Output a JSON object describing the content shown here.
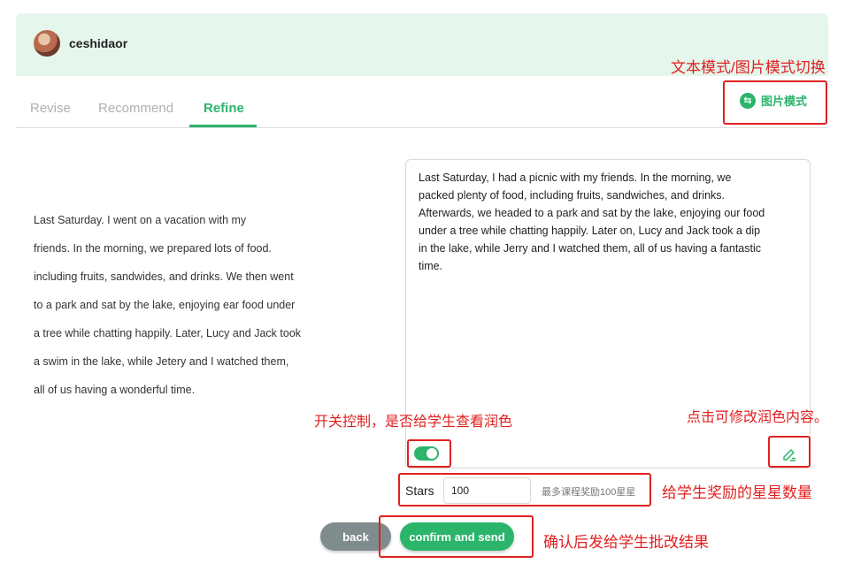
{
  "header": {
    "username": "ceshidaor"
  },
  "tabs": [
    {
      "label": "Revise"
    },
    {
      "label": "Recommend"
    },
    {
      "label": "Refine"
    }
  ],
  "mode_button": {
    "label": "图片模式",
    "icon": "swap-icon"
  },
  "original_text": [
    "Last Saturday. I went on a vacation with my",
    "friends. In the morning, we prepared lots of food.",
    "including fruits, sandwides, and drinks. We then went",
    "to a park and sat by the lake, enjoying ear food under",
    "a tree while chatting happily. Later, Lucy and Jack took",
    "a swim in the lake, while Jetery and I watched them,",
    "all of us having a wonderful time."
  ],
  "refined_text": [
    "Last Saturday, I had a picnic with my friends. In the morning, we",
    "packed plenty of food, including fruits, sandwiches, and drinks.",
    "Afterwards, we headed to a park and sat by the lake, enjoying our food",
    "under a tree while chatting happily. Later on, Lucy and Jack took a dip",
    "in the lake, while Jerry and I watched them, all of us having a fantastic",
    "time."
  ],
  "toggle": {
    "on": true
  },
  "stars": {
    "label": "Stars",
    "value": "100",
    "hint": "最多课程奖励100星星"
  },
  "buttons": {
    "back": "back",
    "confirm": "confirm and send"
  },
  "annotations": {
    "mode_switch": "文本模式/图片模式切换",
    "toggle": "开关控制，是否给学生查看润色",
    "edit": "点击可修改润色内容。",
    "stars": "给学生奖励的星星数量",
    "confirm": "确认后发给学生批改结果"
  },
  "colors": {
    "accent": "#2bb56b",
    "header_bg": "#e5f6ec",
    "annotation": "#e02020",
    "back_button": "#7f8c8d"
  }
}
